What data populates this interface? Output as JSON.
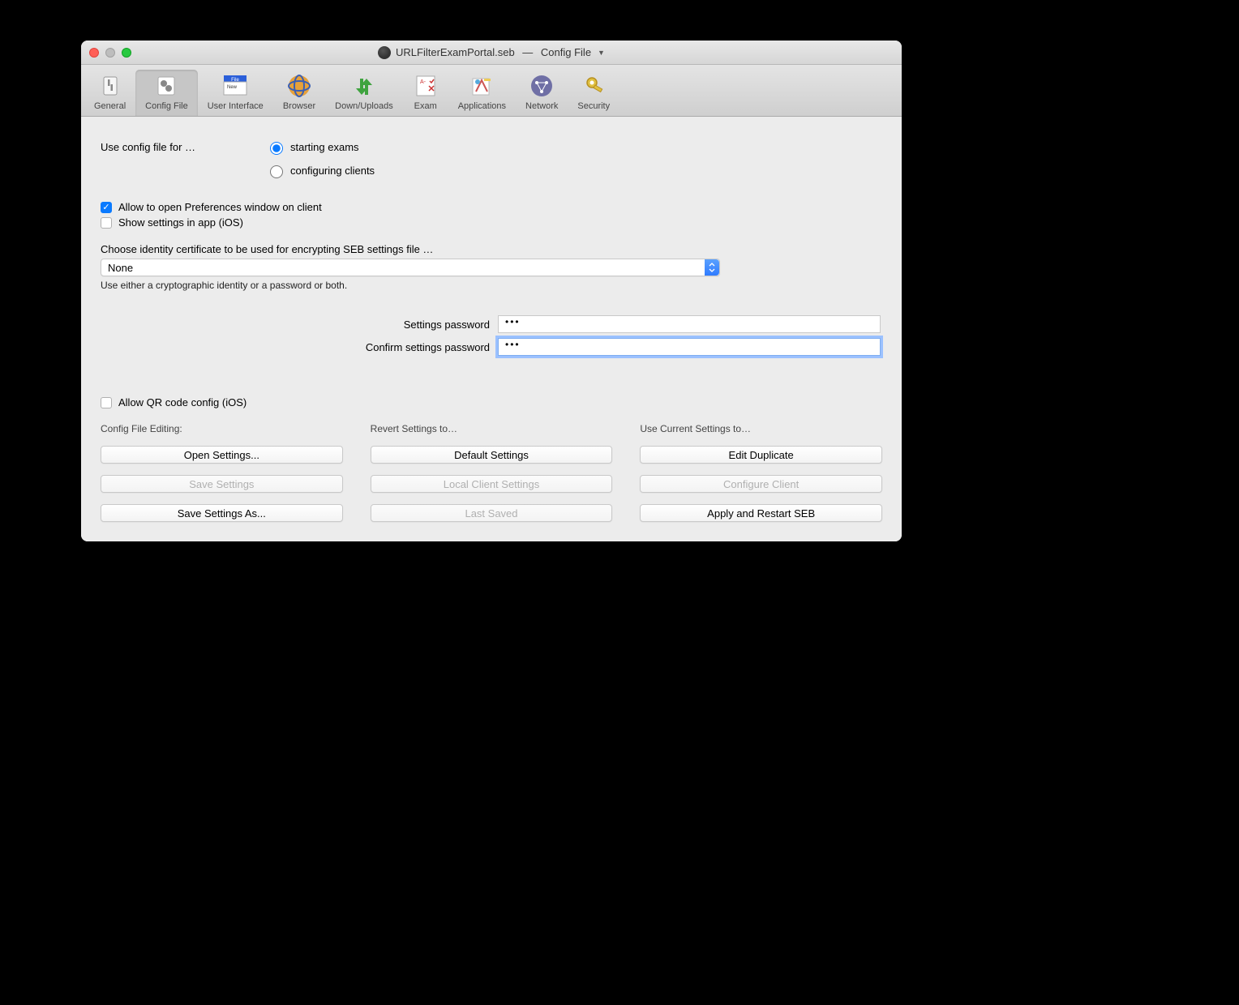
{
  "window": {
    "filename": "URLFilterExamPortal.seb",
    "section": "Config File"
  },
  "toolbar": {
    "items": [
      {
        "label": "General"
      },
      {
        "label": "Config File"
      },
      {
        "label": "User Interface"
      },
      {
        "label": "Browser"
      },
      {
        "label": "Down/Uploads"
      },
      {
        "label": "Exam"
      },
      {
        "label": "Applications"
      },
      {
        "label": "Network"
      },
      {
        "label": "Security"
      }
    ],
    "selected": "Config File"
  },
  "useConfigFor": {
    "label": "Use config file for …",
    "options": [
      {
        "label": "starting exams",
        "selected": true
      },
      {
        "label": "configuring clients",
        "selected": false
      }
    ]
  },
  "checkboxes": {
    "allowPrefs": {
      "label": "Allow to open Preferences window on client",
      "checked": true
    },
    "showSettings": {
      "label": "Show settings in app (iOS)",
      "checked": false
    },
    "allowQR": {
      "label": "Allow QR code config (iOS)",
      "checked": false
    }
  },
  "identity": {
    "label": "Choose identity certificate to be used for encrypting SEB settings file …",
    "value": "None",
    "note": "Use either a cryptographic identity or a password or both."
  },
  "passwords": {
    "settingsLabel": "Settings password",
    "confirmLabel": "Confirm settings password",
    "settingsValue": "•••",
    "confirmValue": "•••"
  },
  "buttonCols": {
    "col1": {
      "header": "Config File Editing:",
      "buttons": [
        {
          "label": "Open Settings...",
          "enabled": true
        },
        {
          "label": "Save Settings",
          "enabled": false
        },
        {
          "label": "Save Settings As...",
          "enabled": true
        }
      ]
    },
    "col2": {
      "header": "Revert Settings to…",
      "buttons": [
        {
          "label": "Default Settings",
          "enabled": true
        },
        {
          "label": "Local Client Settings",
          "enabled": false
        },
        {
          "label": "Last Saved",
          "enabled": false
        }
      ]
    },
    "col3": {
      "header": "Use Current Settings to…",
      "buttons": [
        {
          "label": "Edit Duplicate",
          "enabled": true
        },
        {
          "label": "Configure Client",
          "enabled": false
        },
        {
          "label": "Apply and Restart SEB",
          "enabled": true
        }
      ]
    }
  }
}
